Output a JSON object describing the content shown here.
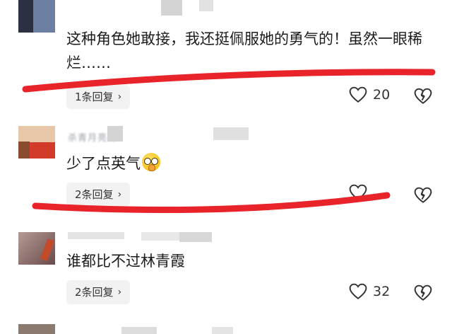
{
  "comments": [
    {
      "text": "这种角色她敢接，我还挺佩服她的勇气的！虽然一眼稀烂……",
      "reply_label": "1条回复",
      "likes": "20"
    },
    {
      "username": "杀青月亮的",
      "text": "少了点英气",
      "reply_label": "2条回复",
      "likes": ""
    },
    {
      "text": "谁都比不过林青霞",
      "reply_label": "2条回复",
      "likes": "32"
    }
  ],
  "icons": {
    "like": "heart-outline-icon",
    "dislike": "broken-heart-icon",
    "reply_chevron": "chevron-right-icon",
    "emoji": "shushing-face-emoji"
  },
  "colors": {
    "annotation_stroke": "#e8232a",
    "reply_bg": "#f2f2f2"
  }
}
